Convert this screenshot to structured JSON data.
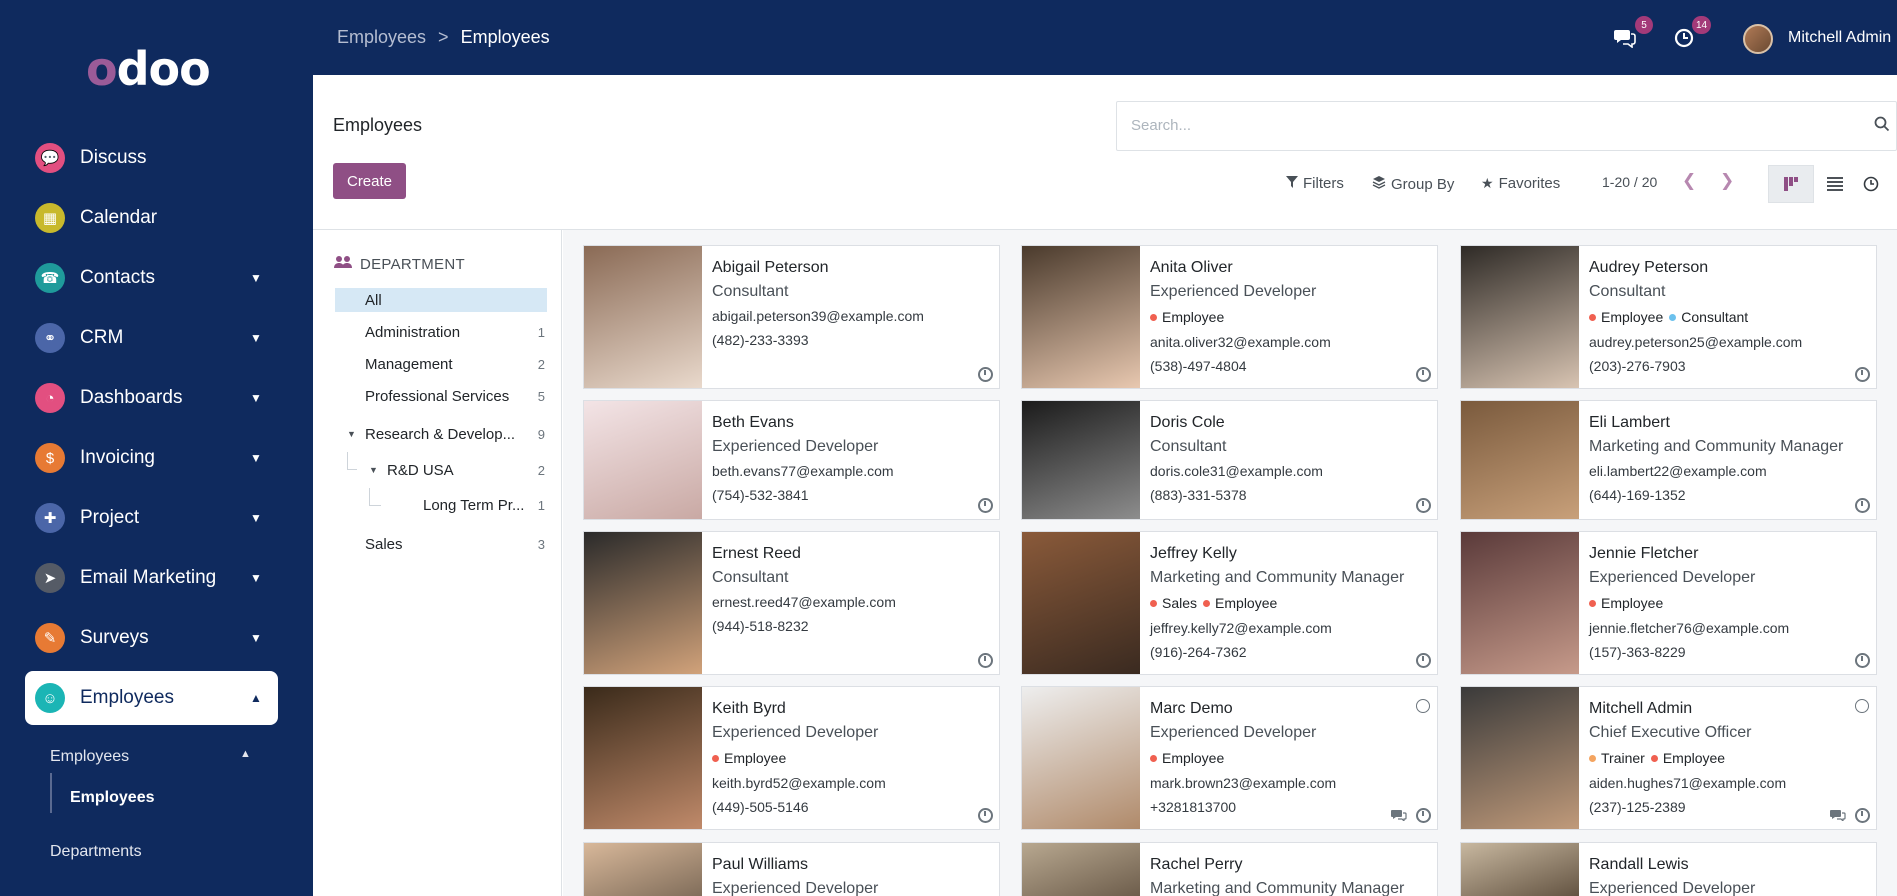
{
  "sidebar": {
    "logo": "odoo",
    "menu": [
      {
        "label": "Discuss",
        "icon": "discuss-icon",
        "color": "#e24f80",
        "glyph": "💬",
        "chevron": false
      },
      {
        "label": "Calendar",
        "icon": "calendar-icon",
        "color": "#c8b92c",
        "glyph": "▦",
        "chevron": false
      },
      {
        "label": "Contacts",
        "icon": "contacts-icon",
        "color": "#1f9b9b",
        "glyph": "☎",
        "chevron": true
      },
      {
        "label": "CRM",
        "icon": "crm-icon",
        "color": "#4b66a8",
        "glyph": "⚭",
        "chevron": true
      },
      {
        "label": "Dashboards",
        "icon": "dashboards-icon",
        "color": "#e24f80",
        "glyph": "◔",
        "chevron": true
      },
      {
        "label": "Invoicing",
        "icon": "invoicing-icon",
        "color": "#e77a34",
        "glyph": "$",
        "chevron": true
      },
      {
        "label": "Project",
        "icon": "project-icon",
        "color": "#4b66a8",
        "glyph": "✚",
        "chevron": true
      },
      {
        "label": "Email Marketing",
        "icon": "email-marketing-icon",
        "color": "#555b66",
        "glyph": "➤",
        "chevron": true
      },
      {
        "label": "Surveys",
        "icon": "surveys-icon",
        "color": "#e77a34",
        "glyph": "✎",
        "chevron": true
      },
      {
        "label": "Employees",
        "icon": "employees-icon",
        "color": "#1bb5b5",
        "glyph": "☺",
        "chevron": true
      }
    ],
    "sub": {
      "employees_group": "Employees",
      "employees_item": "Employees",
      "departments": "Departments"
    }
  },
  "topbar": {
    "breadcrumb_parent": "Employees",
    "breadcrumb_sep": ">",
    "breadcrumb_current": "Employees",
    "messages_badge": "5",
    "activities_badge": "14",
    "user_name": "Mitchell Admin"
  },
  "control": {
    "title": "Employees",
    "create": "Create",
    "search_placeholder": "Search...",
    "filters": "Filters",
    "group_by": "Group By",
    "favorites": "Favorites",
    "pager": "1-20 / 20"
  },
  "departments": {
    "header": "DEPARTMENT",
    "items": [
      {
        "label": "All",
        "count": ""
      },
      {
        "label": "Administration",
        "count": "1"
      },
      {
        "label": "Management",
        "count": "2"
      },
      {
        "label": "Professional Services",
        "count": "5"
      },
      {
        "label": "Research & Develop...",
        "count": "9"
      },
      {
        "label": "R&D USA",
        "count": "2"
      },
      {
        "label": "Long Term Pr...",
        "count": "1"
      },
      {
        "label": "Sales",
        "count": "3"
      }
    ]
  },
  "colors": {
    "brand": "#0f2a5e",
    "accent": "#8f4f85",
    "tag_employee": "#f06050",
    "tag_consultant": "#6cc1ed",
    "tag_sales": "#f06050",
    "tag_trainer": "#f4a460"
  },
  "employees": [
    {
      "name": "Abigail Peterson",
      "job": "Consultant",
      "tags": [],
      "email": "abigail.peterson39@example.com",
      "phone": "(482)-233-3393"
    },
    {
      "name": "Anita Oliver",
      "job": "Experienced Developer",
      "tags": [
        {
          "label": "Employee",
          "color": "#f06050"
        }
      ],
      "email": "anita.oliver32@example.com",
      "phone": "(538)-497-4804"
    },
    {
      "name": "Audrey Peterson",
      "job": "Consultant",
      "tags": [
        {
          "label": "Employee",
          "color": "#f06050"
        },
        {
          "label": "Consultant",
          "color": "#6cc1ed"
        }
      ],
      "email": "audrey.peterson25@example.com",
      "phone": "(203)-276-7903"
    },
    {
      "name": "Beth Evans",
      "job": "Experienced Developer",
      "tags": [],
      "email": "beth.evans77@example.com",
      "phone": "(754)-532-3841"
    },
    {
      "name": "Doris Cole",
      "job": "Consultant",
      "tags": [],
      "email": "doris.cole31@example.com",
      "phone": "(883)-331-5378"
    },
    {
      "name": "Eli Lambert",
      "job": "Marketing and Community Manager",
      "tags": [],
      "email": "eli.lambert22@example.com",
      "phone": "(644)-169-1352"
    },
    {
      "name": "Ernest Reed",
      "job": "Consultant",
      "tags": [],
      "email": "ernest.reed47@example.com",
      "phone": "(944)-518-8232"
    },
    {
      "name": "Jeffrey Kelly",
      "job": "Marketing and Community Manager",
      "tags": [
        {
          "label": "Sales",
          "color": "#f06050"
        },
        {
          "label": "Employee",
          "color": "#f06050"
        }
      ],
      "email": "jeffrey.kelly72@example.com",
      "phone": "(916)-264-7362"
    },
    {
      "name": "Jennie Fletcher",
      "job": "Experienced Developer",
      "tags": [
        {
          "label": "Employee",
          "color": "#f06050"
        }
      ],
      "email": "jennie.fletcher76@example.com",
      "phone": "(157)-363-8229"
    },
    {
      "name": "Keith Byrd",
      "job": "Experienced Developer",
      "tags": [
        {
          "label": "Employee",
          "color": "#f06050"
        }
      ],
      "email": "keith.byrd52@example.com",
      "phone": "(449)-505-5146"
    },
    {
      "name": "Marc Demo",
      "job": "Experienced Developer",
      "tags": [
        {
          "label": "Employee",
          "color": "#f06050"
        }
      ],
      "email": "mark.brown23@example.com",
      "phone": "+3281813700"
    },
    {
      "name": "Mitchell Admin",
      "job": "Chief Executive Officer",
      "tags": [
        {
          "label": "Trainer",
          "color": "#f4a460"
        },
        {
          "label": "Employee",
          "color": "#f06050"
        }
      ],
      "email": "aiden.hughes71@example.com",
      "phone": "(237)-125-2389"
    },
    {
      "name": "Paul Williams",
      "job": "Experienced Developer",
      "tags": [],
      "email": "",
      "phone": ""
    },
    {
      "name": "Rachel Perry",
      "job": "Marketing and Community Manager",
      "tags": [],
      "email": "",
      "phone": ""
    },
    {
      "name": "Randall Lewis",
      "job": "Experienced Developer",
      "tags": [],
      "email": "",
      "phone": ""
    }
  ]
}
